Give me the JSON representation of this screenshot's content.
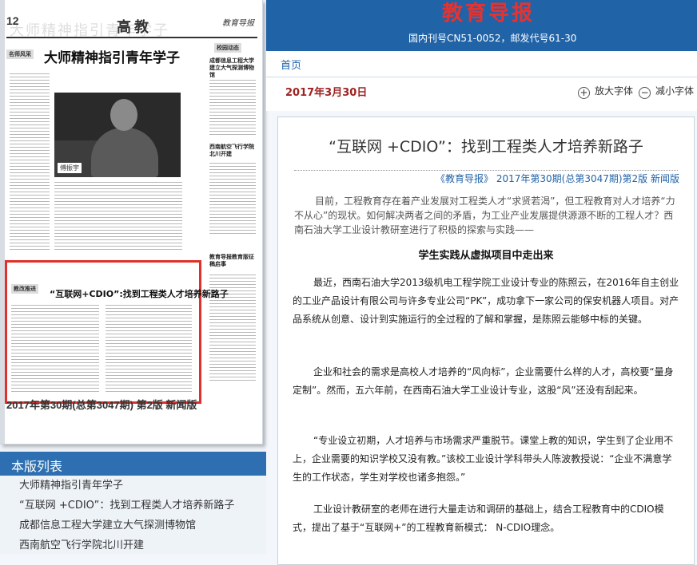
{
  "newspaper": {
    "page_num": "12",
    "section": "高教",
    "brand": "教育导报",
    "watermark": "大师精神指引青年学子",
    "headline": "大师精神指引青年学子",
    "photo_caption": "傅振宇",
    "side_heading_1": "成都信息工程大学建立大气探测博物馆",
    "side_heading_2": "西南航空飞行学院北川开建",
    "box_heading": "教育导报教育版征稿启事",
    "tag_left": "名师风采",
    "tag_right": "校园动态",
    "tag_bottom": "教改推进",
    "highlight_headline": "“互联网+CDIO”:找到工程类人才培养新路子",
    "footer": "2017年第30期(总第3047期) 第2版 新闻版"
  },
  "section_list": {
    "title": "本版列表",
    "items": [
      "大师精神指引青年学子",
      "“互联网 +CDIO”：找到工程类人才培养新路子",
      "成都信息工程大学建立大气探测博物馆",
      "西南航空飞行学院北川开建"
    ]
  },
  "header": {
    "logo": "教育导报",
    "issn": "国内刊号CN51-0052，邮发代号61-30"
  },
  "nav": {
    "home": "首页"
  },
  "date": "2017年3月30日",
  "font_controls": {
    "enlarge": "放大字体",
    "shrink": "减小字体"
  },
  "article": {
    "title": "“互联网 +CDIO”：找到工程类人才培养新路子",
    "meta": "《教育导报》 2017年第30期(总第3047期)第2版 新闻版",
    "lead": "目前，工程教育存在着产业发展对工程类人才“求贤若渴”，但工程教育对人才培养“力不从心”的现状。如何解决两者之间的矛盾，为工业产业发展提供源源不断的工程人才？西南石油大学工业设计教研室进行了积极的探索与实践——",
    "subheading": "学生实践从虚拟项目中走出来",
    "paragraphs": [
      "最近，西南石油大学2013级机电工程学院工业设计专业的陈照云，在2016年自主创业的工业产品设计有限公司与许多专业公司“PK”，成功拿下一家公司的保安机器人项目。对产品系统从创意、设计到实施运行的全过程的了解和掌握，是陈照云能够中标的关键。",
      "企业和社会的需求是高校人才培养的“风向标”，企业需要什么样的人才，高校要“量身定制”。然而，五六年前，在西南石油大学工业设计专业，这股“风”还没有刮起来。",
      "“专业设立初期，人才培养与市场需求严重脱节。课堂上教的知识，学生到了企业用不上，企业需要的知识学校又没有教。”该校工业设计学科带头人陈波教授说：“企业不满意学生的工作状态，学生对学校也诸多抱怨。”",
      "工业设计教研室的老师在进行大量走访和调研的基础上，结合工程教育中的CDIO模式，提出了基于“互联网+”的工程教育新模式： N-CDIO理念。"
    ]
  },
  "colors": {
    "banner": "#2163a7",
    "logo_red": "#e8322e",
    "date_red": "#9e2222",
    "highlight": "#e0302b"
  }
}
